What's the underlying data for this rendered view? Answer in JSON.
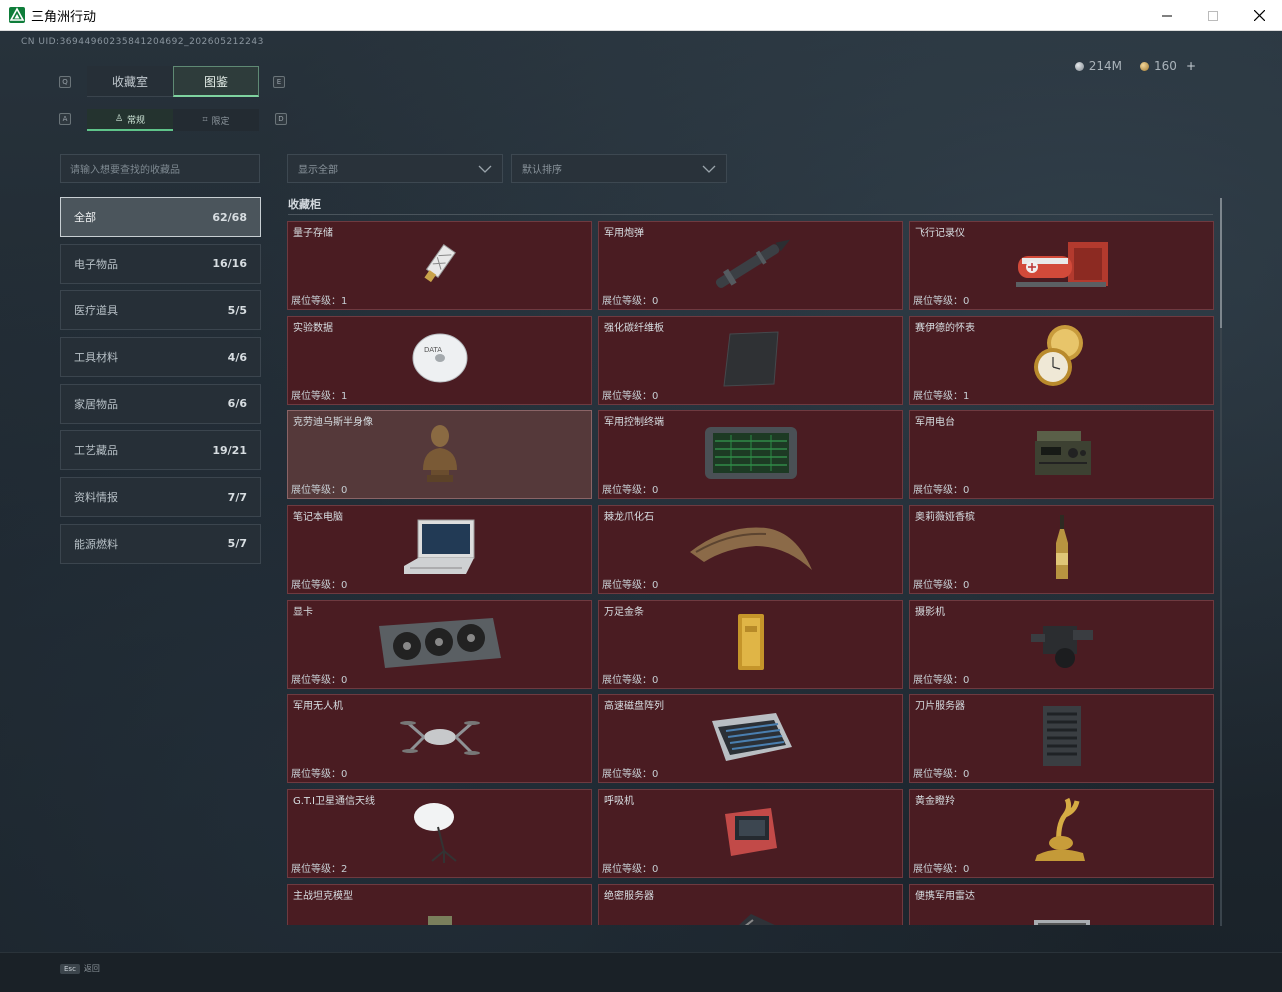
{
  "window": {
    "title": "三角洲行动"
  },
  "header": {
    "uid": "CN UID:369449602358412046​92_202605212243",
    "currency_silver": "214M",
    "currency_gold": "160",
    "plus": "+"
  },
  "tabs": [
    {
      "label": "收藏室"
    },
    {
      "label": "图鉴"
    }
  ],
  "key_hints": {
    "left_tab": "Q",
    "right_tab": "E",
    "left_sub": "A",
    "right_sub": "D"
  },
  "subtabs": [
    {
      "label": "常规",
      "icon": "trophy-icon"
    },
    {
      "label": "限定",
      "icon": "limited-icon"
    }
  ],
  "search": {
    "placeholder": "请输入想要查找的收藏品"
  },
  "filters": {
    "show": "显示全部",
    "sort": "默认排序"
  },
  "categories": [
    {
      "label": "全部",
      "count": "62/68"
    },
    {
      "label": "电子物品",
      "count": "16/16"
    },
    {
      "label": "医疗道具",
      "count": "5/5"
    },
    {
      "label": "工具材料",
      "count": "4/6"
    },
    {
      "label": "家居物品",
      "count": "6/6"
    },
    {
      "label": "工艺藏品",
      "count": "19/21"
    },
    {
      "label": "资料情报",
      "count": "7/7"
    },
    {
      "label": "能源燃料",
      "count": "5/7"
    }
  ],
  "section": {
    "title": "收藏柜"
  },
  "items": [
    {
      "name": "量子存储",
      "level": "展位等级：1",
      "icon": "usb-drive-icon"
    },
    {
      "name": "军用炮弹",
      "level": "展位等级：0",
      "icon": "missile-icon"
    },
    {
      "name": "飞行记录仪",
      "level": "展位等级：0",
      "icon": "flight-recorder-icon"
    },
    {
      "name": "实验数据",
      "level": "展位等级：1",
      "icon": "disc-icon"
    },
    {
      "name": "强化碳纤维板",
      "level": "展位等级：0",
      "icon": "carbon-plate-icon"
    },
    {
      "name": "赛伊德的怀表",
      "level": "展位等级：1",
      "icon": "pocket-watch-icon"
    },
    {
      "name": "克劳迪乌斯半身像",
      "level": "展位等级：0",
      "icon": "bust-icon"
    },
    {
      "name": "军用控制终端",
      "level": "展位等级：0",
      "icon": "terminal-icon"
    },
    {
      "name": "军用电台",
      "level": "展位等级：0",
      "icon": "radio-icon"
    },
    {
      "name": "笔记本电脑",
      "level": "展位等级：0",
      "icon": "laptop-icon"
    },
    {
      "name": "棘龙爪化石",
      "level": "展位等级：0",
      "icon": "claw-fossil-icon"
    },
    {
      "name": "奥莉薇娅香槟",
      "level": "展位等级：0",
      "icon": "champagne-icon"
    },
    {
      "name": "显卡",
      "level": "展位等级：0",
      "icon": "gpu-icon"
    },
    {
      "name": "万足金条",
      "level": "展位等级：0",
      "icon": "gold-bar-icon"
    },
    {
      "name": "摄影机",
      "level": "展位等级：0",
      "icon": "camera-icon"
    },
    {
      "name": "军用无人机",
      "level": "展位等级：0",
      "icon": "drone-icon"
    },
    {
      "name": "高速磁盘阵列",
      "level": "展位等级：0",
      "icon": "disk-array-icon"
    },
    {
      "name": "刀片服务器",
      "level": "展位等级：0",
      "icon": "blade-server-icon"
    },
    {
      "name": "G.T.I卫星通信天线",
      "level": "展位等级：2",
      "icon": "satellite-dish-icon"
    },
    {
      "name": "呼吸机",
      "level": "展位等级：0",
      "icon": "ventilator-icon"
    },
    {
      "name": "黄金瞪羚",
      "level": "展位等级：0",
      "icon": "gold-gazelle-icon"
    },
    {
      "name": "主战坦克模型",
      "level": "",
      "icon": "tank-model-icon"
    },
    {
      "name": "绝密服务器",
      "level": "",
      "icon": "secret-server-icon"
    },
    {
      "name": "便携军用雷达",
      "level": "",
      "icon": "radar-icon"
    }
  ],
  "footer": {
    "esc_key": "Esc",
    "esc_label": "返回"
  }
}
